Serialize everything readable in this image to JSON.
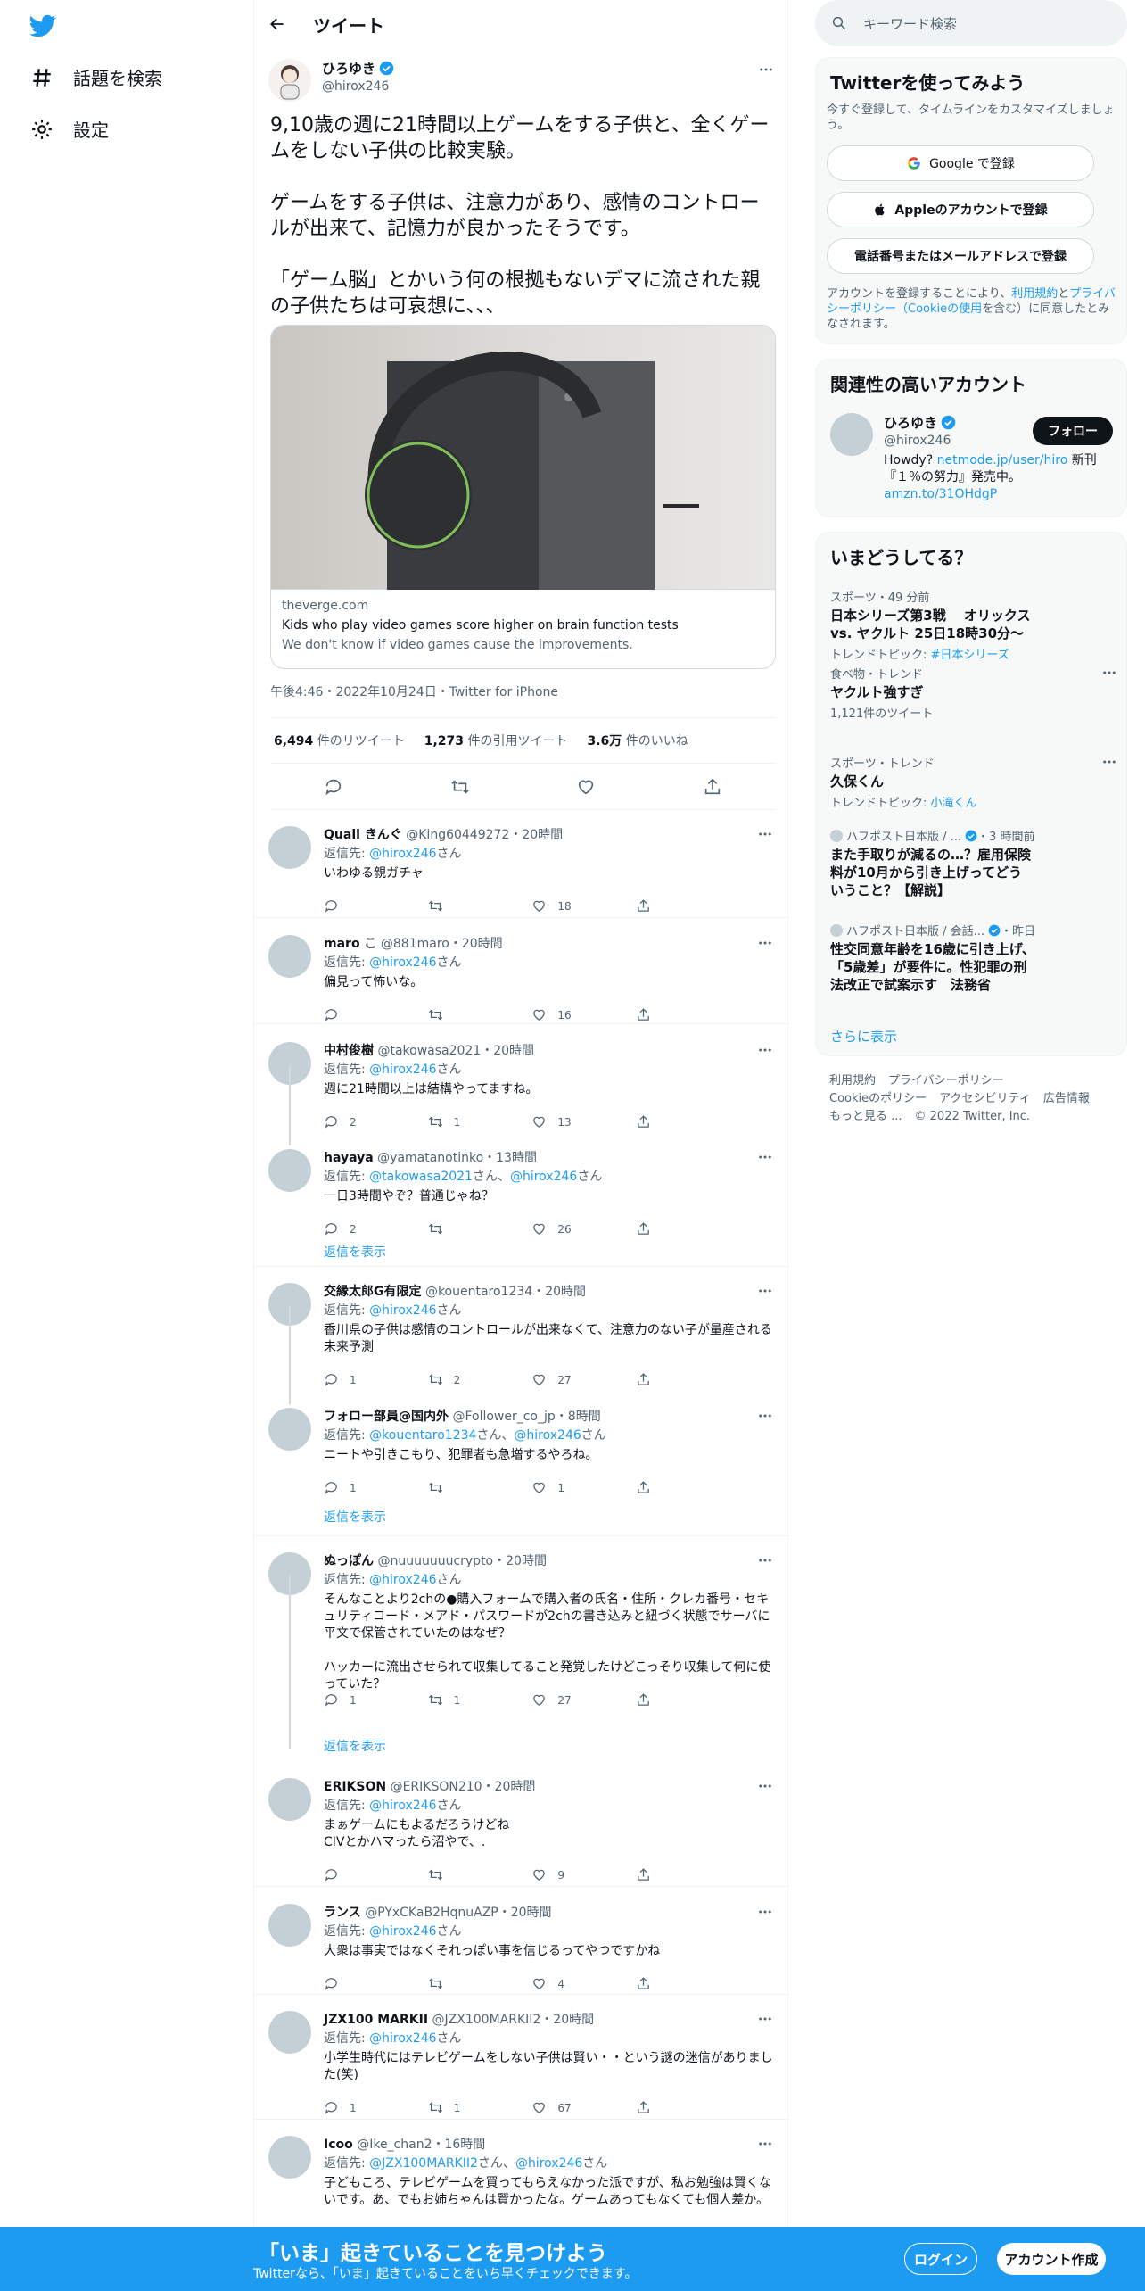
{
  "nav": {
    "explore": "話題を検索",
    "settings": "設定"
  },
  "header": {
    "title": "ツイート"
  },
  "tweet": {
    "name": "ひろゆき",
    "handle": "@hirox246",
    "text": "9,10歳の週に21時間以上ゲームをする子供と、全くゲームをしない子供の比較実験。\n\nゲームをする子供は、注意力があり、感情のコントロールが出来て、記憶力が良かったそうです。\n\n「ゲーム脳」とかいう何の根拠もないデマに流された親の子供たちは可哀想に、、、",
    "card": {
      "site": "theverge.com",
      "title": "Kids who play video games score higher on brain function tests",
      "desc": "We don't know if video games cause the improvements."
    },
    "timestamp": "午後4:46・2022年10月24日・Twitter for iPhone",
    "stats": {
      "retweets": "6,494",
      "retweets_label": "件のリツイート",
      "quotes": "1,273",
      "quotes_label": "件の引用ツイート",
      "likes": "3.6万",
      "likes_label": "件のいいね"
    }
  },
  "replies": [
    {
      "name": "Quail きんぐ",
      "handle": "@King60449272",
      "time": "20時間",
      "to": "@hirox246",
      "to_suffix": "さん",
      "text": "いわゆる親ガチャ",
      "reply": "",
      "rt": "",
      "like": "18"
    },
    {
      "name": "maro こ",
      "handle": "@881maro",
      "time": "20時間",
      "to": "@hirox246",
      "to_suffix": "さん",
      "text": "偏見って怖いな。",
      "reply": "",
      "rt": "",
      "like": "16"
    },
    {
      "name": "中村俊樹",
      "handle": "@takowasa2021",
      "time": "20時間",
      "to": "@hirox246",
      "to_suffix": "さん",
      "text": "週に21時間以上は結構やってますね。",
      "reply": "2",
      "rt": "1",
      "like": "13"
    },
    {
      "name": "hayaya",
      "handle": "@yamatanotinko",
      "time": "13時間",
      "to": "@takowasa2021",
      "to2": "@hirox246",
      "to_mid": "さん、",
      "to_suffix": "さん",
      "text": "一日3時間やぞ？普通じゃね？",
      "reply": "2",
      "rt": "",
      "like": "26"
    },
    {
      "name": "交縁太郎G有限定",
      "handle": "@kouentaro1234",
      "time": "20時間",
      "to": "@hirox246",
      "to_suffix": "さん",
      "text": "香川県の子供は感情のコントロールが出来なくて、注意力のない子が量産される未来予測",
      "reply": "1",
      "rt": "2",
      "like": "27"
    },
    {
      "name": "フォロー部員@国内外",
      "handle": "@Follower_co_jp",
      "time": "8時間",
      "to": "@kouentaro1234",
      "to2": "@hirox246",
      "to_mid": "さん、",
      "to_suffix": "さん",
      "text": "ニートや引きこもり、犯罪者も急増するやろね。",
      "reply": "1",
      "rt": "",
      "like": "1"
    },
    {
      "name": "ぬっぽん",
      "handle": "@nuuuuuuucrypto",
      "time": "20時間",
      "to": "@hirox246",
      "to_suffix": "さん",
      "text": "そんなことより2chの●購入フォームで購入者の氏名・住所・クレカ番号・セキュリティコード・メアド・パスワードが2chの書き込みと紐づく状態でサーバに平文で保管されていたのはなぜ？\n\nハッカーに流出させられて収集してること発覚したけどこっそり収集して何に使っていた？",
      "reply": "1",
      "rt": "1",
      "like": "27"
    },
    {
      "name": "ERIKSON",
      "handle": "@ERIKSON210",
      "time": "20時間",
      "to": "@hirox246",
      "to_suffix": "さん",
      "text": "まぁゲームにもよるだろうけどね\nCIVとかハマったら沼やで、.",
      "reply": "",
      "rt": "",
      "like": "9"
    },
    {
      "name": "ランス",
      "handle": "@PYxCKaB2HqnuAZP",
      "time": "20時間",
      "to": "@hirox246",
      "to_suffix": "さん",
      "text": "大衆は事実ではなくそれっぽい事を信じるってやつですかね",
      "reply": "",
      "rt": "",
      "like": "4"
    },
    {
      "name": "JZX100 MARKII",
      "handle": "@JZX100MARKII2",
      "time": "20時間",
      "to": "@hirox246",
      "to_suffix": "さん",
      "text": "小学生時代にはテレビゲームをしない子供は賢い・・という謎の迷信がありました(笑)",
      "reply": "1",
      "rt": "1",
      "like": "67"
    },
    {
      "name": "Icoo",
      "handle": "@Ike_chan2",
      "time": "16時間",
      "to": "@JZX100MARKII2",
      "to2": "@hirox246",
      "to_mid": "さん、",
      "to_suffix": "さん",
      "text": "子どもころ、テレビゲームを買ってもらえなかった派ですが、私お勉強は賢くないです。あ、でもお姉ちゃんは賢かったな。ゲームあってもなくても個人差か。",
      "reply": "",
      "rt": "",
      "like": ""
    }
  ],
  "reply_to_label": "返信先: ",
  "show_replies": "返信を表示",
  "search": {
    "placeholder": "キーワード検索"
  },
  "signup": {
    "title": "Twitterを使ってみよう",
    "subtitle": "今すぐ登録して、タイムラインをカスタマイズしましょう。",
    "google": "Google で登録",
    "apple": "Appleのアカウントで登録",
    "phone": "電話番号またはメールアドレスで登録",
    "terms_a": "アカウントを登録することにより、",
    "terms_link1": "利用規約",
    "terms_b": "と",
    "terms_link2": "プライバシーポリシー（Cookieの使用",
    "terms_c": "を含む）に同意したとみなされます。"
  },
  "related": {
    "title": "関連性の高いアカウント",
    "name": "ひろゆき",
    "handle": "@hirox246",
    "follow": "フォロー",
    "bio_a": "Howdy? ",
    "bio_link": "netmode.jp/user/hiro",
    "bio_b": " 新刊『１％の努力』発売中。",
    "bio_link2": "amzn.to/31OHdgP"
  },
  "trends": {
    "title": "いまどうしてる？",
    "items": [
      {
        "meta": "スポーツ・49 分前",
        "name": "日本シリーズ第3戦　 オリックス vs. ヤクルト 25日18時30分〜",
        "sub": "トレンドトピック: ",
        "sub_link": "#日本シリーズ"
      },
      {
        "meta": "食べ物・トレンド",
        "name": "ヤクルト強すぎ",
        "sub": "1,121件のツイート",
        "sub_link": ""
      },
      {
        "meta": "スポーツ・トレンド",
        "name": "久保くん",
        "sub": "トレンドトピック: ",
        "sub_link": "小滝くん"
      },
      {
        "meta": "ハフポスト日本版 / ...",
        "meta_time": "・3 時間前",
        "name": "また手取りが減るの…？雇用保険料が10月から引き上げってどういうこと？【解説】",
        "sub": "",
        "sub_link": ""
      },
      {
        "meta": "ハフポスト日本版 / 会話...",
        "meta_time": "・昨日",
        "name": "性交同意年齢を16歳に引き上げ、「5歳差」が要件に。性犯罪の刑法改正で試案示す　法務省",
        "sub": "",
        "sub_link": ""
      }
    ],
    "more": "さらに表示"
  },
  "footer": {
    "l1": "利用規約",
    "l2": "プライバシーポリシー",
    "l3": "Cookieのポリシー",
    "l4": "アクセシビリティ",
    "l5": "広告情報",
    "l6": "もっと見る ...",
    "l7": "© 2022 Twitter, Inc."
  },
  "bottom": {
    "title": "「いま」起きていることを見つけよう",
    "subtitle": "Twitterなら、「いま」起きていることをいち早くチェックできます。",
    "login": "ログイン",
    "signup": "アカウント作成"
  },
  "colors": {
    "accent": "#1d9bf0",
    "text": "#0f1419",
    "muted": "#536471"
  }
}
